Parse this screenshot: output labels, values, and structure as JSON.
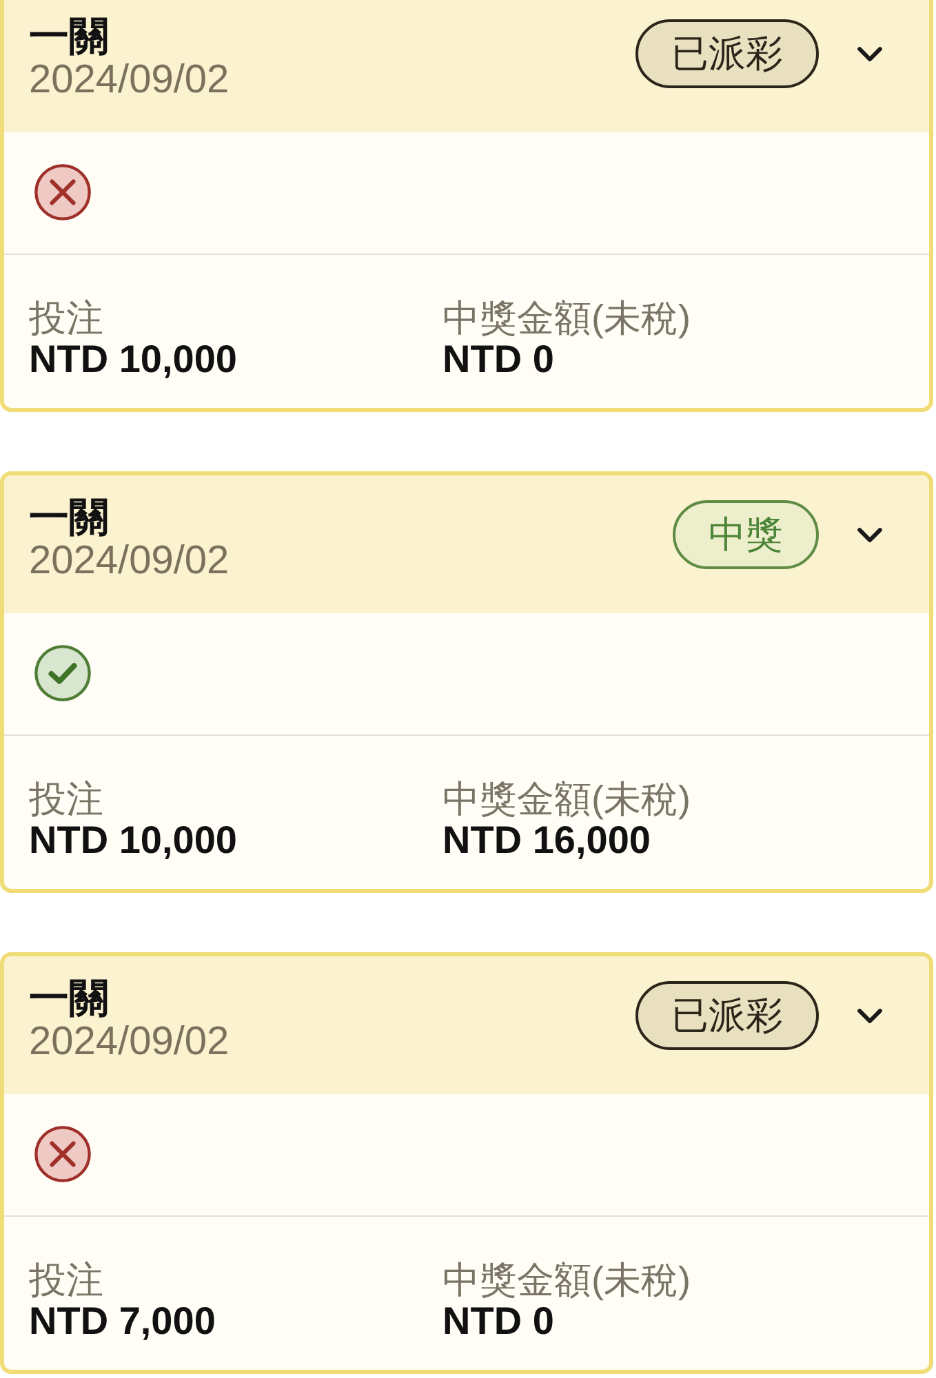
{
  "bets": [
    {
      "title": "一關",
      "date": "2024/09/02",
      "status": {
        "label": "已派彩",
        "kind": "paid"
      },
      "result": {
        "kind": "lose"
      },
      "stats": [
        {
          "label": "投注",
          "value": "NTD 10,000"
        },
        {
          "label": "中獎金額(未稅)",
          "value": "NTD 0"
        }
      ]
    },
    {
      "title": "一關",
      "date": "2024/09/02",
      "status": {
        "label": "中獎",
        "kind": "won"
      },
      "result": {
        "kind": "win"
      },
      "stats": [
        {
          "label": "投注",
          "value": "NTD 10,000"
        },
        {
          "label": "中獎金額(未稅)",
          "value": "NTD 16,000"
        }
      ]
    },
    {
      "title": "一關",
      "date": "2024/09/02",
      "status": {
        "label": "已派彩",
        "kind": "paid"
      },
      "result": {
        "kind": "lose"
      },
      "stats": [
        {
          "label": "投注",
          "value": "NTD 7,000"
        },
        {
          "label": "中獎金額(未稅)",
          "value": "NTD 0"
        }
      ]
    }
  ]
}
